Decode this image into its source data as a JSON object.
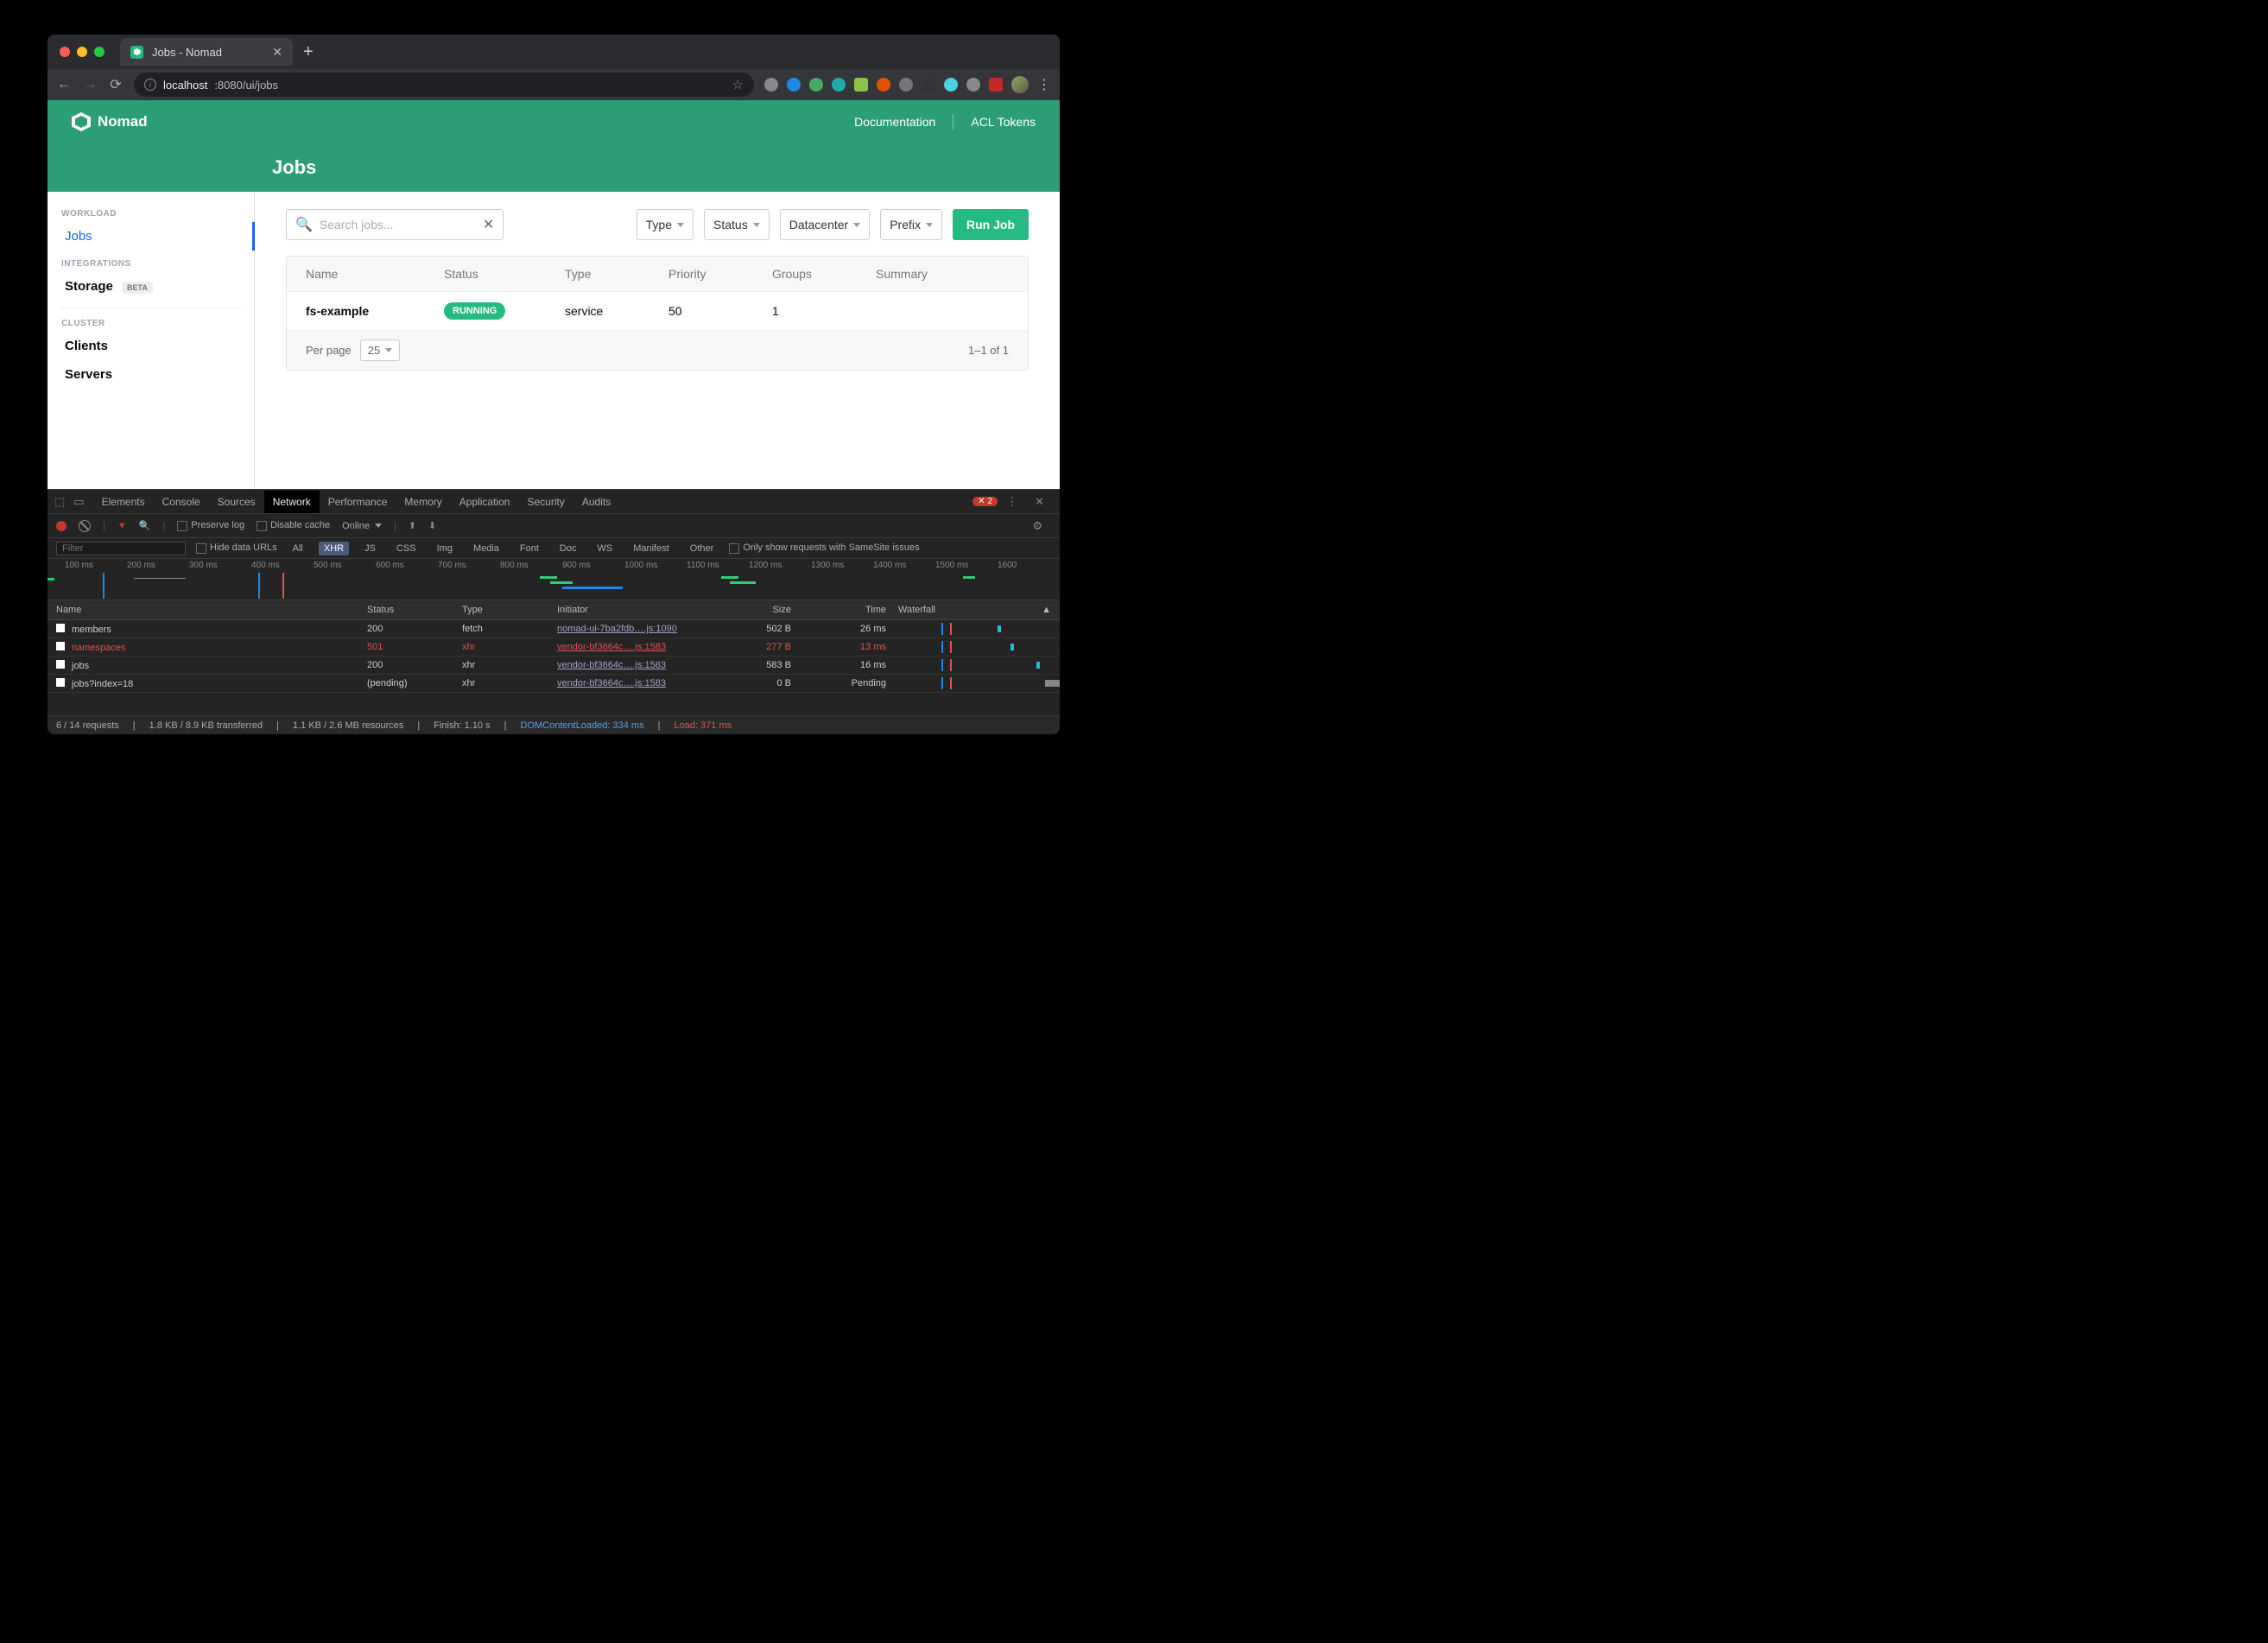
{
  "browser": {
    "tab_title": "Jobs - Nomad",
    "url": "localhost:8080/ui/jobs",
    "url_host": "localhost",
    "url_path": ":8080/ui/jobs"
  },
  "header": {
    "product": "Nomad",
    "links": {
      "docs": "Documentation",
      "acl": "ACL Tokens"
    }
  },
  "page": {
    "title": "Jobs"
  },
  "sidebar": {
    "sections": {
      "workload": "WORKLOAD",
      "integrations": "INTEGRATIONS",
      "cluster": "CLUSTER"
    },
    "items": {
      "jobs": "Jobs",
      "storage": "Storage",
      "storage_badge": "BETA",
      "clients": "Clients",
      "servers": "Servers"
    }
  },
  "toolbar": {
    "search_placeholder": "Search jobs...",
    "filters": {
      "type": "Type",
      "status": "Status",
      "dc": "Datacenter",
      "prefix": "Prefix"
    },
    "run": "Run Job"
  },
  "table": {
    "cols": {
      "name": "Name",
      "status": "Status",
      "type": "Type",
      "priority": "Priority",
      "groups": "Groups",
      "summary": "Summary"
    },
    "rows": [
      {
        "name": "fs-example",
        "status": "RUNNING",
        "type": "service",
        "priority": "50",
        "groups": "1"
      }
    ],
    "footer": {
      "perpage_label": "Per page",
      "perpage_value": "25",
      "range": "1–1 of 1"
    }
  },
  "devtools": {
    "tabs": [
      "Elements",
      "Console",
      "Sources",
      "Network",
      "Performance",
      "Memory",
      "Application",
      "Security",
      "Audits"
    ],
    "active_tab": "Network",
    "error_count": "2",
    "toolbar": {
      "preserve": "Preserve log",
      "disable_cache": "Disable cache",
      "online": "Online"
    },
    "filter": {
      "placeholder": "Filter",
      "hide_data": "Hide data URLs",
      "types": [
        "All",
        "XHR",
        "JS",
        "CSS",
        "Img",
        "Media",
        "Font",
        "Doc",
        "WS",
        "Manifest",
        "Other"
      ],
      "active_type": "XHR",
      "samesite": "Only show requests with SameSite issues"
    },
    "timeline_ticks": [
      "100 ms",
      "200 ms",
      "300 ms",
      "400 ms",
      "500 ms",
      "600 ms",
      "700 ms",
      "800 ms",
      "900 ms",
      "1000 ms",
      "1100 ms",
      "1200 ms",
      "1300 ms",
      "1400 ms",
      "1500 ms",
      "1600"
    ],
    "table": {
      "cols": {
        "name": "Name",
        "status": "Status",
        "type": "Type",
        "initiator": "Initiator",
        "size": "Size",
        "time": "Time",
        "waterfall": "Waterfall"
      },
      "rows": [
        {
          "name": "members",
          "status": "200",
          "type": "fetch",
          "initiator": "nomad-ui-7ba2fdb….js:1090",
          "size": "502 B",
          "time": "26 ms",
          "err": false
        },
        {
          "name": "namespaces",
          "status": "501",
          "type": "xhr",
          "initiator": "vendor-bf3664c….js:1583",
          "size": "277 B",
          "time": "13 ms",
          "err": true
        },
        {
          "name": "jobs",
          "status": "200",
          "type": "xhr",
          "initiator": "vendor-bf3664c….js:1583",
          "size": "583 B",
          "time": "16 ms",
          "err": false
        },
        {
          "name": "jobs?index=18",
          "status": "(pending)",
          "type": "xhr",
          "initiator": "vendor-bf3664c….js:1583",
          "size": "0 B",
          "time": "Pending",
          "err": false
        }
      ]
    },
    "status": {
      "requests": "6 / 14 requests",
      "transferred": "1.8 KB / 8.9 KB transferred",
      "resources": "1.1 KB / 2.6 MB resources",
      "finish": "Finish: 1.10 s",
      "dcl": "DOMContentLoaded: 334 ms",
      "load": "Load: 371 ms"
    }
  }
}
